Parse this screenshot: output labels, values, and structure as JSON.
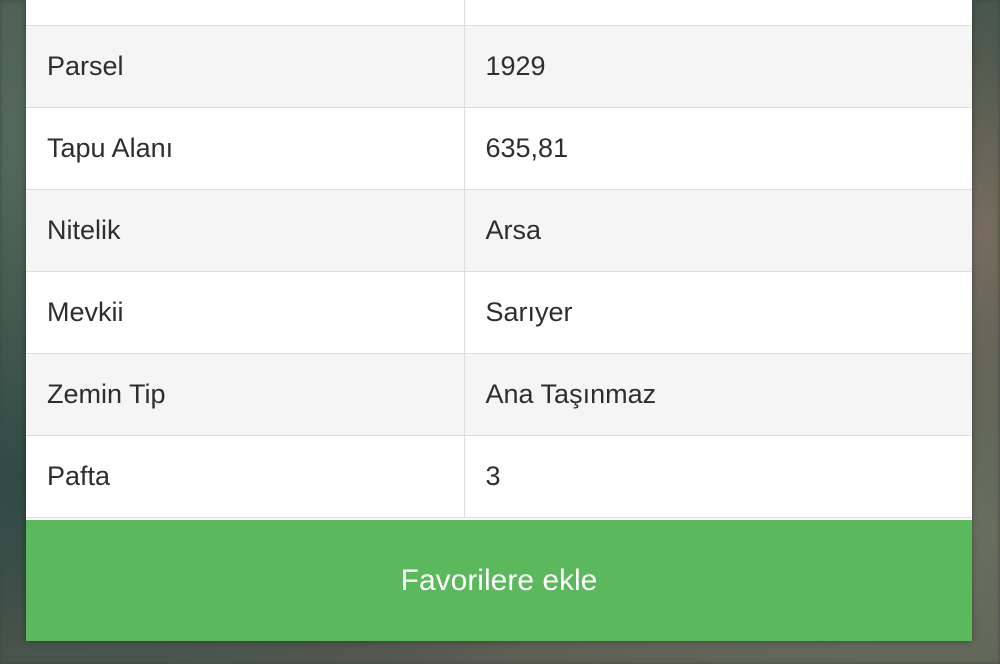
{
  "table": {
    "rows": [
      {
        "label": "",
        "value": ""
      },
      {
        "label": "Parsel",
        "value": "1929"
      },
      {
        "label": "Tapu Alanı",
        "value": "635,81"
      },
      {
        "label": "Nitelik",
        "value": "Arsa"
      },
      {
        "label": "Mevkii",
        "value": "Sarıyer"
      },
      {
        "label": "Zemin Tip",
        "value": "Ana Taşınmaz"
      },
      {
        "label": "Pafta",
        "value": "3"
      }
    ]
  },
  "actions": {
    "favorite_label": "Favorilere ekle"
  },
  "colors": {
    "button": "#5cb85c",
    "row_alt": "#f5f5f5"
  }
}
